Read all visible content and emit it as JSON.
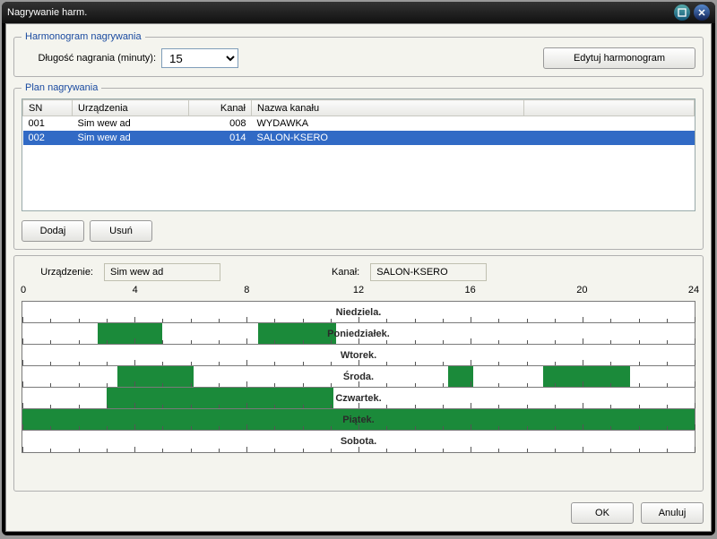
{
  "title": "Nagrywanie harm.",
  "sections": {
    "schedule_legend": "Harmonogram nagrywania",
    "plan_legend": "Plan nagrywania"
  },
  "labels": {
    "duration": "Długość nagrania (minuty):",
    "edit_schedule": "Edytuj harmonogram",
    "add": "Dodaj",
    "remove": "Usuń",
    "device": "Urządzenie:",
    "channel": "Kanał:",
    "ok": "OK",
    "cancel": "Anuluj"
  },
  "duration_value": "15",
  "table": {
    "headers": {
      "sn": "SN",
      "dev": "Urządzenia",
      "ch": "Kanał",
      "cname": "Nazwa kanału"
    },
    "rows": [
      {
        "sn": "001",
        "dev": "Sim wew ad",
        "ch": "008",
        "cname": "WYDAWKA",
        "selected": false
      },
      {
        "sn": "002",
        "dev": "Sim wew ad",
        "ch": "014",
        "cname": "SALON-KSERO",
        "selected": true
      }
    ]
  },
  "selected": {
    "device": "Sim wew ad",
    "channel": "SALON-KSERO"
  },
  "axis": {
    "labels": [
      "0",
      "4",
      "8",
      "12",
      "16",
      "20",
      "24"
    ]
  },
  "days": [
    {
      "name": "Niedziela.",
      "segments": []
    },
    {
      "name": "Poniedziałek.",
      "segments": [
        [
          2.7,
          5.0
        ],
        [
          8.4,
          11.2
        ]
      ]
    },
    {
      "name": "Wtorek.",
      "segments": []
    },
    {
      "name": "Środa.",
      "segments": [
        [
          3.4,
          6.1
        ],
        [
          15.2,
          16.1
        ],
        [
          18.6,
          21.7
        ]
      ]
    },
    {
      "name": "Czwartek.",
      "segments": [
        [
          3.0,
          11.1
        ]
      ]
    },
    {
      "name": "Piątek.",
      "segments": [
        [
          0,
          24
        ]
      ]
    },
    {
      "name": "Sobota.",
      "segments": []
    }
  ],
  "colors": {
    "seg": "#1b8a3a",
    "selection": "#316ac5"
  }
}
